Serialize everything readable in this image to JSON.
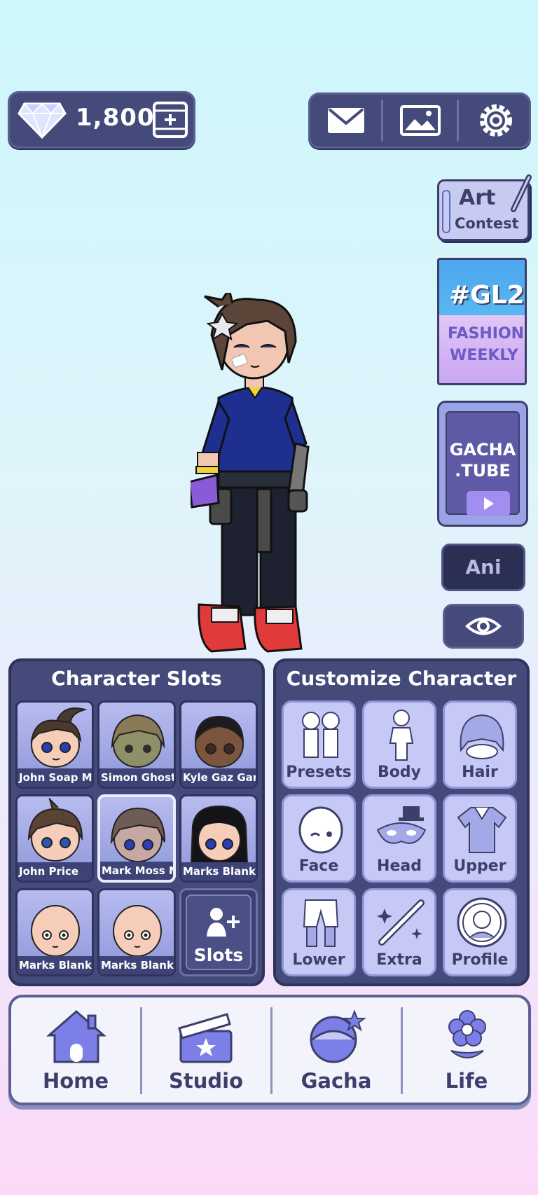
{
  "currency": {
    "amount": "1,800",
    "icon": "diamond-icon",
    "add_icon": "add-currency-icon"
  },
  "top_icons": [
    "mail-icon",
    "gallery-icon",
    "settings-icon"
  ],
  "side": {
    "art_contest": {
      "line1": "Art",
      "line2": "Contest"
    },
    "fashion": {
      "tag": "#GL2",
      "line1": "FASHION",
      "line2": "WEEKLY"
    },
    "gacha_tube": {
      "line1": "GACHA",
      "line2": ".TUBE"
    },
    "ani_label": "Ani"
  },
  "character_slots": {
    "title": "Character Slots",
    "slots": [
      {
        "label": "John Soap Ma"
      },
      {
        "label": "Simon Ghost R"
      },
      {
        "label": "Kyle Gaz Garr"
      },
      {
        "label": "John Price"
      },
      {
        "label": "Mark Moss Mc"
      },
      {
        "label": "Marks Blank M"
      },
      {
        "label": "Marks Blank M"
      },
      {
        "label": "Marks Blank M"
      }
    ],
    "add_slots_label": "Slots"
  },
  "customize": {
    "title": "Customize Character",
    "buttons": [
      {
        "label": "Presets"
      },
      {
        "label": "Body"
      },
      {
        "label": "Hair"
      },
      {
        "label": "Face"
      },
      {
        "label": "Head"
      },
      {
        "label": "Upper"
      },
      {
        "label": "Lower"
      },
      {
        "label": "Extra"
      },
      {
        "label": "Profile"
      }
    ]
  },
  "nav": {
    "items": [
      {
        "label": "Home"
      },
      {
        "label": "Studio"
      },
      {
        "label": "Gacha"
      },
      {
        "label": "Life"
      }
    ]
  },
  "colors": {
    "panel": "#444a7a",
    "accent": "#c6c9f5",
    "nav_bg": "#f3f3fb"
  }
}
